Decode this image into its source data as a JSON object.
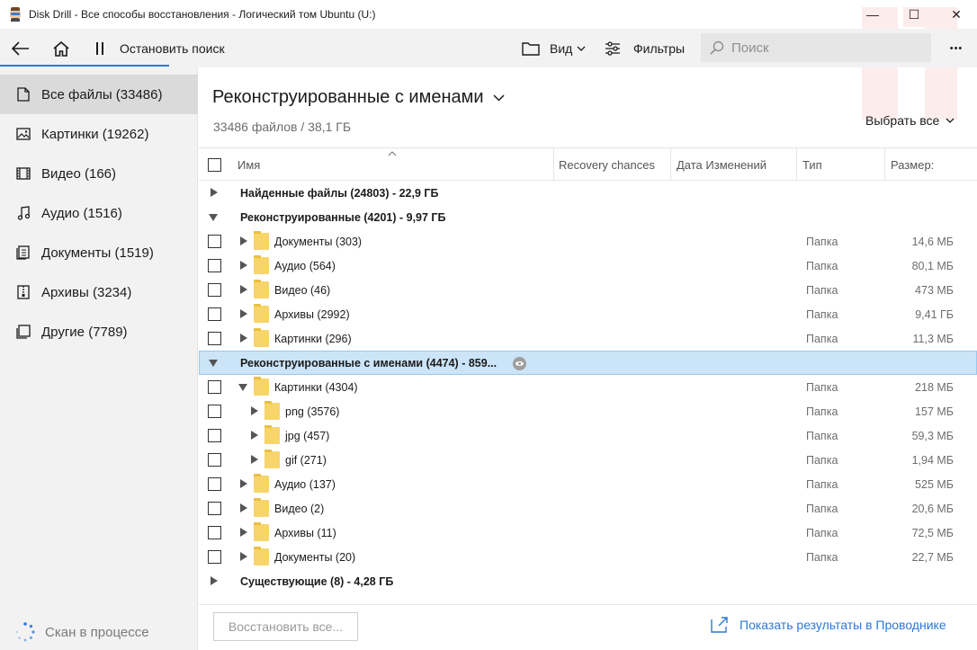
{
  "window": {
    "title": "Disk Drill - Все способы восстановления - Логический том Ubuntu (U:)",
    "minimize_glyph": "—",
    "maximize_glyph": "☐",
    "close_glyph": "✕"
  },
  "toolbar": {
    "stop_label": "Остановить поиск",
    "view_label": "Вид",
    "filters_label": "Фильтры",
    "search_placeholder": "Поиск",
    "more_glyph": "•••"
  },
  "sidebar": {
    "items": [
      {
        "label": "Все файлы (33486)",
        "icon": "file-icon",
        "selected": true
      },
      {
        "label": "Картинки (19262)",
        "icon": "image-icon",
        "selected": false
      },
      {
        "label": "Видео (166)",
        "icon": "film-icon",
        "selected": false
      },
      {
        "label": "Аудио (1516)",
        "icon": "music-note-icon",
        "selected": false
      },
      {
        "label": "Документы (1519)",
        "icon": "document-icon",
        "selected": false
      },
      {
        "label": "Архивы (3234)",
        "icon": "archive-icon",
        "selected": false
      },
      {
        "label": "Другие (7789)",
        "icon": "other-files-icon",
        "selected": false
      }
    ],
    "status": "Скан в процессе"
  },
  "main": {
    "title": "Реконструированные с именами",
    "subtitle": "33486 файлов / 38,1 ГБ",
    "select_all": "Выбрать все"
  },
  "table": {
    "columns": {
      "name": "Имя",
      "recovery": "Recovery chances",
      "date": "Дата Изменений",
      "type": "Тип",
      "size": "Размер:"
    },
    "rows": [
      {
        "kind": "group",
        "expanded": false,
        "label": "Найденные файлы (24803) - 22,9 ГБ"
      },
      {
        "kind": "group",
        "expanded": true,
        "label": "Реконструированные (4201) - 9,97 ГБ"
      },
      {
        "kind": "folder",
        "level": 1,
        "expanded": false,
        "name": "Документы (303)",
        "type": "Папка",
        "size": "14,6 МБ"
      },
      {
        "kind": "folder",
        "level": 1,
        "expanded": false,
        "name": "Аудио (564)",
        "type": "Папка",
        "size": "80,1 МБ"
      },
      {
        "kind": "folder",
        "level": 1,
        "expanded": false,
        "name": "Видео (46)",
        "type": "Папка",
        "size": "473 МБ"
      },
      {
        "kind": "folder",
        "level": 1,
        "expanded": false,
        "name": "Архивы (2992)",
        "type": "Папка",
        "size": "9,41 ГБ"
      },
      {
        "kind": "folder",
        "level": 1,
        "expanded": false,
        "name": "Картинки (296)",
        "type": "Папка",
        "size": "11,3 МБ"
      },
      {
        "kind": "group",
        "expanded": true,
        "highlight": true,
        "label": "Реконструированные с именами (4474) - 859..."
      },
      {
        "kind": "folder",
        "level": 1,
        "expanded": true,
        "name": "Картинки (4304)",
        "type": "Папка",
        "size": "218 МБ"
      },
      {
        "kind": "folder",
        "level": 2,
        "expanded": false,
        "name": "png (3576)",
        "type": "Папка",
        "size": "157 МБ"
      },
      {
        "kind": "folder",
        "level": 2,
        "expanded": false,
        "name": "jpg (457)",
        "type": "Папка",
        "size": "59,3 МБ"
      },
      {
        "kind": "folder",
        "level": 2,
        "expanded": false,
        "name": "gif (271)",
        "type": "Папка",
        "size": "1,94 МБ"
      },
      {
        "kind": "folder",
        "level": 1,
        "expanded": false,
        "name": "Аудио (137)",
        "type": "Папка",
        "size": "525 МБ"
      },
      {
        "kind": "folder",
        "level": 1,
        "expanded": false,
        "name": "Видео (2)",
        "type": "Папка",
        "size": "20,6 МБ"
      },
      {
        "kind": "folder",
        "level": 1,
        "expanded": false,
        "name": "Архивы (11)",
        "type": "Папка",
        "size": "72,5 МБ"
      },
      {
        "kind": "folder",
        "level": 1,
        "expanded": false,
        "name": "Документы (20)",
        "type": "Папка",
        "size": "22,7 МБ"
      },
      {
        "kind": "group",
        "expanded": false,
        "label": "Существующие (8) - 4,28 ГБ"
      }
    ]
  },
  "footer": {
    "restore_label": "Восстановить все...",
    "explorer_label": "Показать результаты в Проводнике"
  },
  "colors": {
    "accent": "#2b79d6",
    "selection": "#cce4f7",
    "folder": "#f7d56a",
    "sidebar_bg": "#f2f2f2"
  }
}
